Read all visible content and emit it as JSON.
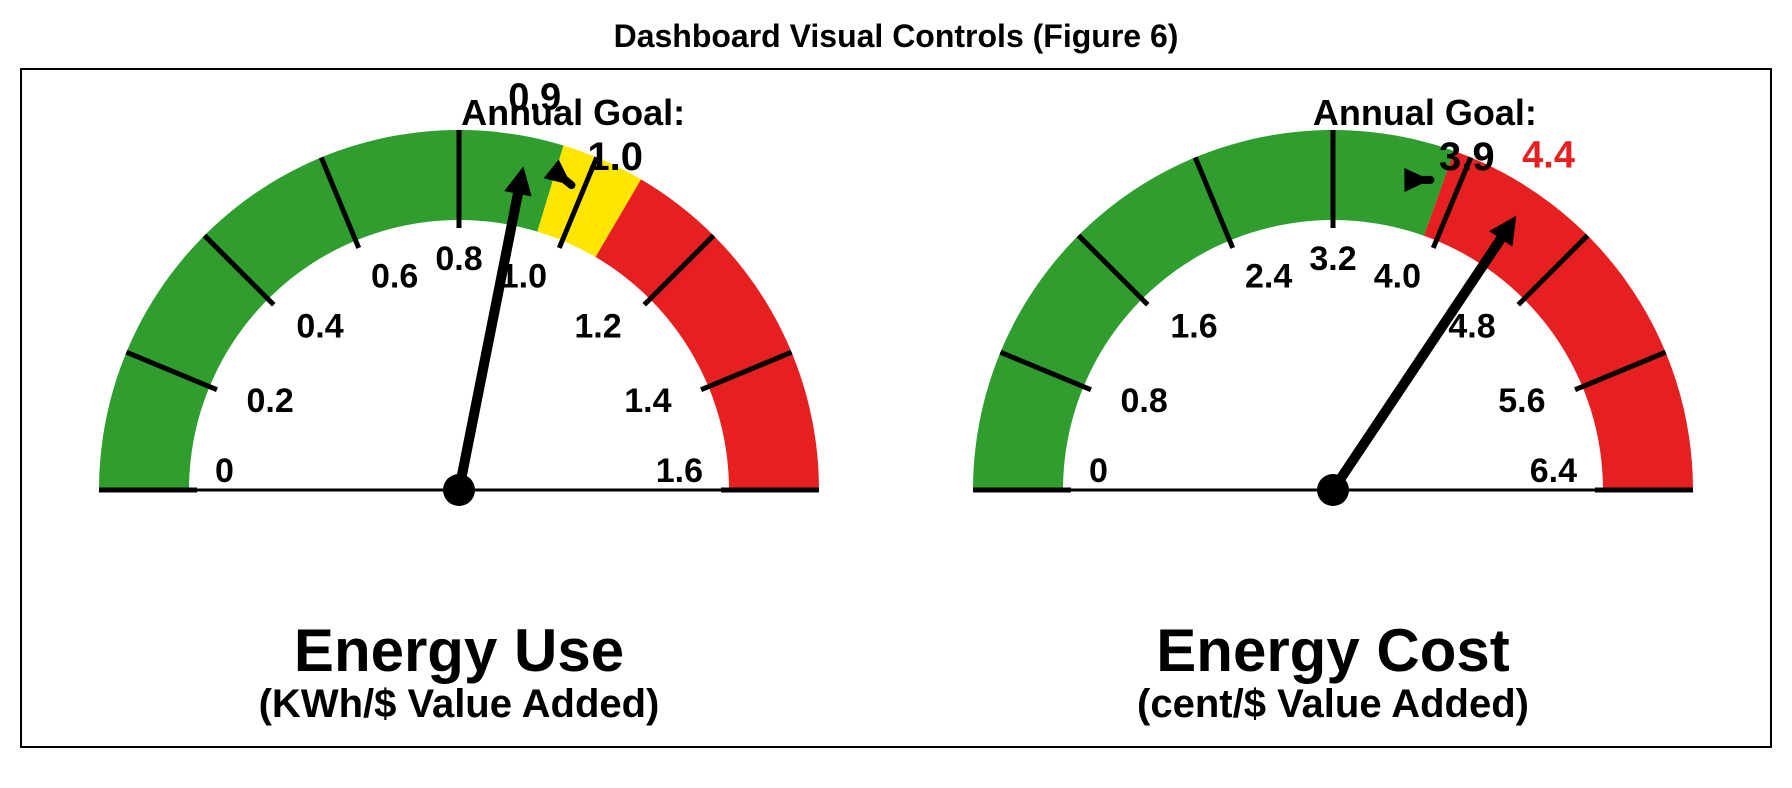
{
  "figure_title": "Dashboard Visual Controls (Figure 6)",
  "gauges": [
    {
      "id": "energy-use",
      "title": "Energy Use",
      "unit": "(KWh/$ Value Added)",
      "min": 0,
      "max": 1.6,
      "ticks": [
        0,
        0.2,
        0.4,
        0.6,
        0.8,
        1.0,
        1.2,
        1.4,
        1.6
      ],
      "zones": [
        {
          "from": 0,
          "to": 0.95,
          "color": "#2f9e2f"
        },
        {
          "from": 0.95,
          "to": 1.07,
          "color": "#ffe600"
        },
        {
          "from": 1.07,
          "to": 1.6,
          "color": "#e62020"
        }
      ],
      "value": 0.9,
      "value_color": "#000000",
      "annual_goal_label": "Annual Goal:",
      "annual_goal_value": 1.0,
      "annual_goal_value_str": "1.0",
      "goal_arrow_target": 0.98
    },
    {
      "id": "energy-cost",
      "title": "Energy Cost",
      "unit": "(cent/$ Value Added)",
      "min": 0,
      "max": 6.4,
      "ticks": [
        0,
        0.8,
        1.6,
        2.4,
        3.2,
        4.0,
        4.8,
        5.6,
        6.4
      ],
      "zones": [
        {
          "from": 0,
          "to": 3.9,
          "color": "#2f9e2f"
        },
        {
          "from": 3.9,
          "to": 6.4,
          "color": "#e62020"
        }
      ],
      "value": 4.4,
      "value_color": "#e62020",
      "annual_goal_label": "Annual Goal:",
      "annual_goal_value": 3.9,
      "annual_goal_value_str": "3.9",
      "goal_arrow_target": 3.82
    }
  ],
  "chart_data": [
    {
      "type": "gauge",
      "title": "Energy Use",
      "unit": "KWh/$ Value Added",
      "range": [
        0,
        1.6
      ],
      "ticks": [
        0,
        0.2,
        0.4,
        0.6,
        0.8,
        1.0,
        1.2,
        1.4,
        1.6
      ],
      "zones": [
        {
          "label": "green",
          "range": [
            0,
            0.95
          ]
        },
        {
          "label": "yellow",
          "range": [
            0.95,
            1.07
          ]
        },
        {
          "label": "red",
          "range": [
            1.07,
            1.6
          ]
        }
      ],
      "needle_value": 0.9,
      "annual_goal": 1.0
    },
    {
      "type": "gauge",
      "title": "Energy Cost",
      "unit": "cent/$ Value Added",
      "range": [
        0,
        6.4
      ],
      "ticks": [
        0,
        0.8,
        1.6,
        2.4,
        3.2,
        4.0,
        4.8,
        5.6,
        6.4
      ],
      "zones": [
        {
          "label": "green",
          "range": [
            0,
            3.9
          ]
        },
        {
          "label": "red",
          "range": [
            3.9,
            6.4
          ]
        }
      ],
      "needle_value": 4.4,
      "annual_goal": 3.9
    }
  ]
}
